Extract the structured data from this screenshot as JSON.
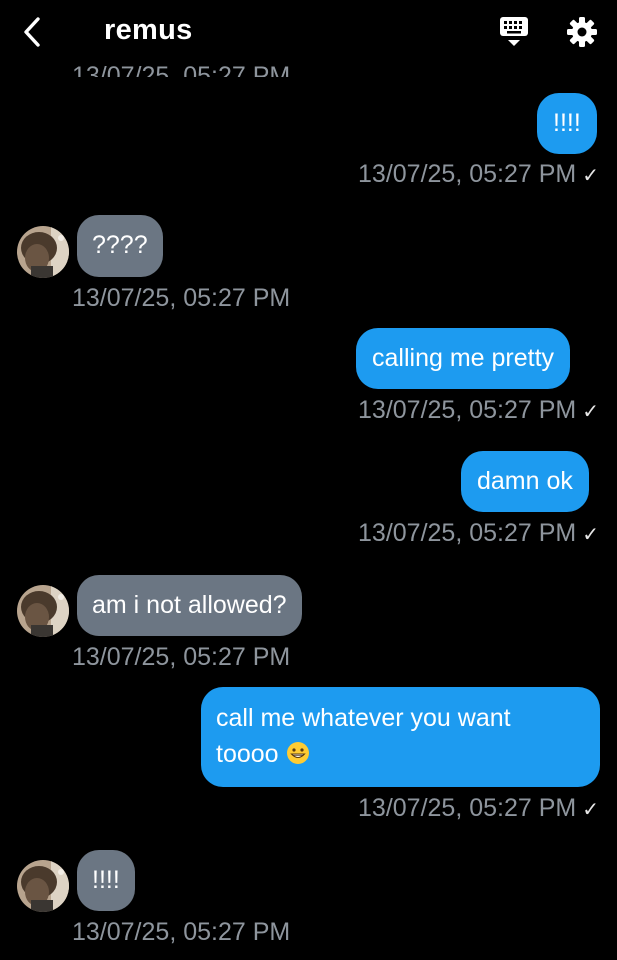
{
  "header": {
    "title": "remus",
    "back_icon": "chevron-left-icon",
    "keyboard_icon": "keyboard-icon",
    "settings_icon": "gear-icon"
  },
  "colors": {
    "background": "#000000",
    "outgoing_bubble": "#1d9bf0",
    "incoming_bubble": "#6b7683",
    "timestamp": "#8e959d"
  },
  "partial_timestamp": "13/07/25, 05:27 PM",
  "messages": [
    {
      "direction": "out",
      "text": "!!!!",
      "timestamp": "13/07/25, 05:27 PM",
      "status": "✓"
    },
    {
      "direction": "in",
      "text": "????",
      "timestamp": "13/07/25, 05:27 PM"
    },
    {
      "direction": "out",
      "text": "calling me pretty",
      "timestamp": "13/07/25, 05:27 PM",
      "status": "✓"
    },
    {
      "direction": "out",
      "text": "damn ok",
      "timestamp": "13/07/25, 05:27 PM",
      "status": "✓"
    },
    {
      "direction": "in",
      "text": "am i not allowed?",
      "timestamp": "13/07/25, 05:27 PM"
    },
    {
      "direction": "out",
      "text_line1": "call me whatever you want",
      "text_line2": "toooo",
      "emoji": "grinning-face-emoji",
      "timestamp": "13/07/25, 05:27 PM",
      "status": "✓"
    },
    {
      "direction": "in",
      "text": "!!!!",
      "timestamp": "13/07/25, 05:27 PM"
    }
  ]
}
